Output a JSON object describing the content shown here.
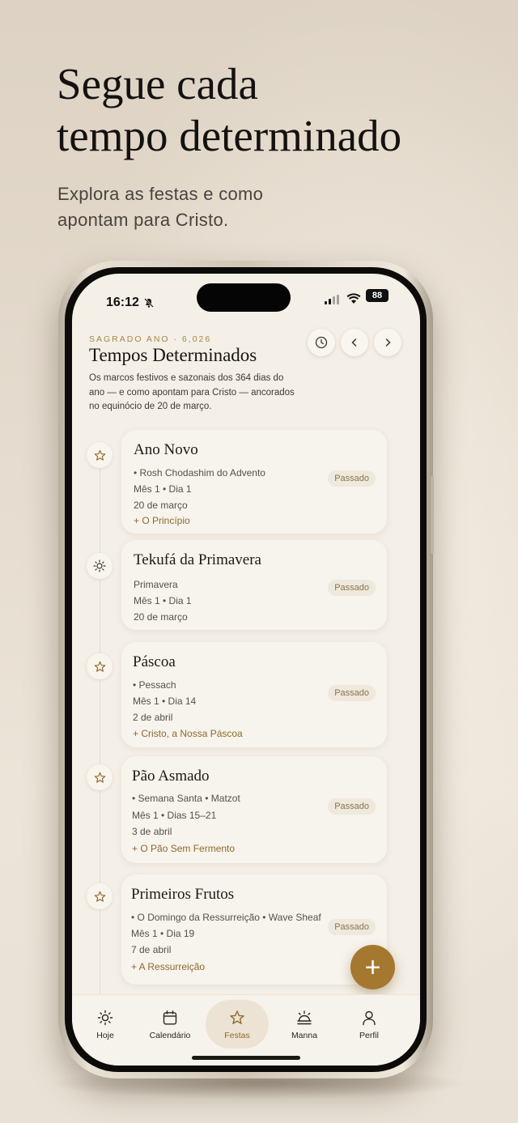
{
  "promo": {
    "headline_line1": "Segue cada",
    "headline_line2": "tempo determinado",
    "subhead_line1": "Explora as festas e como",
    "subhead_line2": "apontam para Cristo."
  },
  "status_bar": {
    "time": "16:12",
    "battery": "88"
  },
  "header": {
    "year_label": "SAGRADO ANO · 6,026",
    "title": "Tempos Determinados",
    "description": "Os marcos festivos e sazonais dos 364 dias do ano — e como apontam para Cristo — ancorados no equinócio de 20 de março."
  },
  "feasts": [
    {
      "icon": "star-icon",
      "title": "Ano Novo",
      "subtitle": "•  Rosh Chodashim do Advento",
      "month_day": "Mês 1  •  Dia 1",
      "date": "20 de março",
      "link": "+  O Princípio",
      "status": "Passado"
    },
    {
      "icon": "sun-icon",
      "title": "Tekufá da Primavera",
      "subtitle": "Primavera",
      "month_day": "Mês 1  •  Dia 1",
      "date": "20 de março",
      "link": "",
      "status": "Passado"
    },
    {
      "icon": "star-icon",
      "title": "Páscoa",
      "subtitle": "•  Pessach",
      "month_day": "Mês 1  •  Dia 14",
      "date": "2 de abril",
      "link": "+  Cristo, a Nossa Páscoa",
      "status": "Passado"
    },
    {
      "icon": "star-icon",
      "title": "Pão Asmado",
      "subtitle": "•  Semana Santa  •  Matzot",
      "month_day": "Mês 1  •  Dias 15–21",
      "date": "3 de abril",
      "link": "+  O Pão Sem Fermento",
      "status": "Passado"
    },
    {
      "icon": "star-icon",
      "title": "Primeiros Frutos",
      "subtitle": "•  O Domingo da Ressurreição  •  Wave Sheaf",
      "month_day": "Mês 1  •  Dia 19",
      "date": "7 de abril",
      "link": "+  A Ressurreição",
      "status": "Passado"
    }
  ],
  "tabs": [
    {
      "label": "Hoje",
      "icon": "sun-icon",
      "active": false
    },
    {
      "label": "Calendário",
      "icon": "calendar-icon",
      "active": false
    },
    {
      "label": "Festas",
      "icon": "star-icon",
      "active": true
    },
    {
      "label": "Manna",
      "icon": "sunrise-icon",
      "active": false
    },
    {
      "label": "Perfil",
      "icon": "person-icon",
      "active": false
    }
  ],
  "fab_label": "+",
  "colors": {
    "accent": "#a5782f",
    "accent_text": "#8d6a2c",
    "screen_bg": "#f4efe7",
    "card_bg": "#f7f3ed"
  }
}
